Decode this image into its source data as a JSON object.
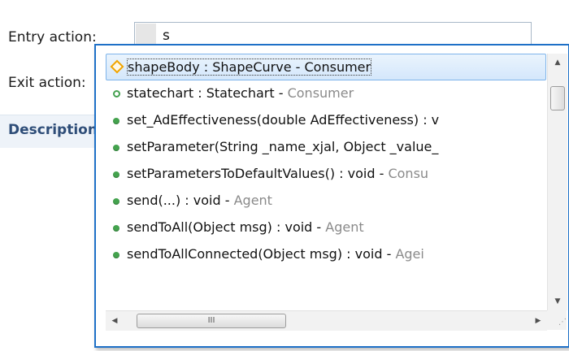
{
  "form": {
    "entry_label": "Entry action:",
    "entry_value": "s",
    "exit_label": "Exit action:",
    "description_tab": "Description"
  },
  "popup": {
    "items": [
      {
        "icon": "field-diamond-icon",
        "name": "shapeBody : ShapeCurve",
        "sep": " - ",
        "owner": "Consumer",
        "selected": true
      },
      {
        "icon": "field-ring-icon",
        "name": "statechart : Statechart",
        "sep": " - ",
        "owner": "Consumer",
        "selected": false
      },
      {
        "icon": "method-dot-icon",
        "name": "set_AdEffectiveness(double AdEffectiveness) : v",
        "sep": "",
        "owner": "",
        "selected": false
      },
      {
        "icon": "method-dot-icon",
        "name": "setParameter(String _name_xjal, Object _value_",
        "sep": "",
        "owner": "",
        "selected": false
      },
      {
        "icon": "method-dot-icon",
        "name": "setParametersToDefaultValues() : void",
        "sep": " - ",
        "owner": "Consu",
        "selected": false
      },
      {
        "icon": "method-dot-icon",
        "name": "send(...) : void",
        "sep": " - ",
        "owner": "Agent",
        "selected": false
      },
      {
        "icon": "method-dot-icon",
        "name": "sendToAll(Object msg) : void",
        "sep": " - ",
        "owner": "Agent",
        "selected": false
      },
      {
        "icon": "method-dot-icon",
        "name": "sendToAllConnected(Object msg) : void",
        "sep": " - ",
        "owner": "Agei",
        "selected": false
      }
    ],
    "scrollbar": {
      "up_glyph": "▲",
      "down_glyph": "▼",
      "left_glyph": "◀",
      "right_glyph": "▶",
      "thumb_grip": "III",
      "resize_grip": "⋰"
    }
  },
  "colors": {
    "accent": "#1e70c7",
    "method_green": "#44a34e",
    "field_orange": "#f0a400",
    "owner_gray": "#8a8a8a",
    "section_blue": "#2e4d78"
  }
}
